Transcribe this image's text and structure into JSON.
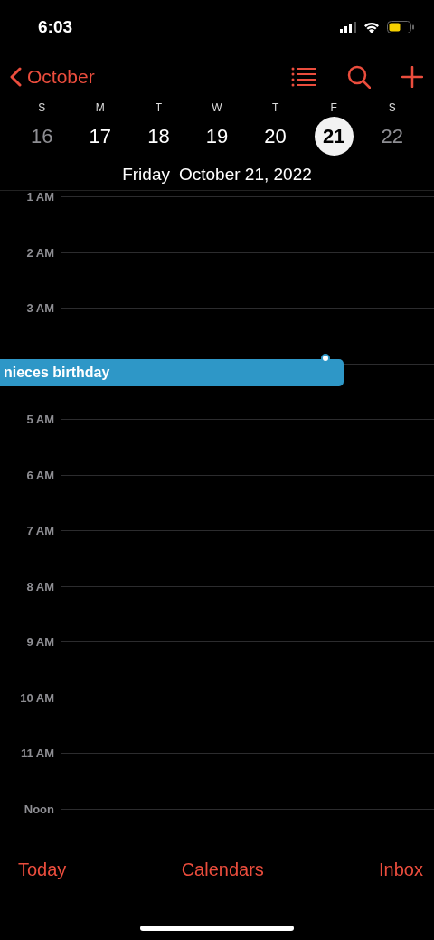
{
  "status_bar": {
    "time": "6:03"
  },
  "nav": {
    "back_label": "October"
  },
  "week": [
    {
      "letter": "S",
      "date": "16",
      "selected": false,
      "weekend": true
    },
    {
      "letter": "M",
      "date": "17",
      "selected": false,
      "weekend": false
    },
    {
      "letter": "T",
      "date": "18",
      "selected": false,
      "weekend": false
    },
    {
      "letter": "W",
      "date": "19",
      "selected": false,
      "weekend": false
    },
    {
      "letter": "T",
      "date": "20",
      "selected": false,
      "weekend": false
    },
    {
      "letter": "F",
      "date": "21",
      "selected": true,
      "weekend": false
    },
    {
      "letter": "S",
      "date": "22",
      "selected": false,
      "weekend": true
    }
  ],
  "selected_day": {
    "weekday": "Friday",
    "date": "October 21, 2022"
  },
  "hours": [
    {
      "label": "1 AM"
    },
    {
      "label": "2 AM"
    },
    {
      "label": "3 AM"
    },
    {
      "events": [
        {
          "title": "nieces birthday",
          "color": "#2e97c7"
        }
      ]
    },
    {
      "label": "5 AM"
    },
    {
      "label": "6 AM"
    },
    {
      "label": "7 AM"
    },
    {
      "label": "8 AM"
    },
    {
      "label": "9 AM"
    },
    {
      "label": "10 AM"
    },
    {
      "label": "11 AM"
    },
    {
      "label": "Noon"
    }
  ],
  "toolbar": [
    "Today",
    "Calendars",
    "Inbox"
  ]
}
